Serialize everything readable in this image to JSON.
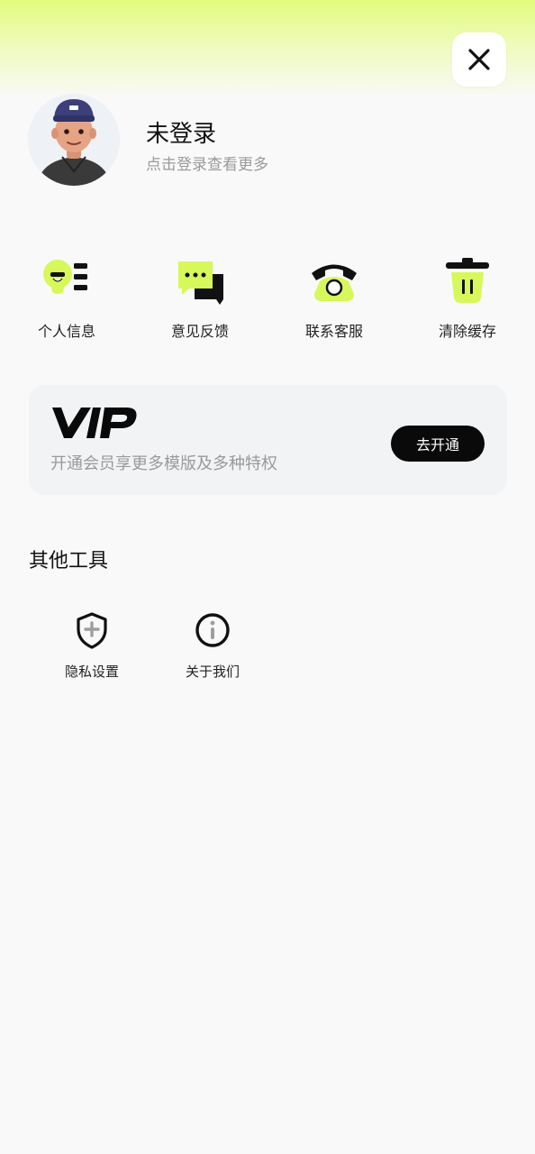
{
  "header": {
    "close_icon": "close-icon"
  },
  "profile": {
    "name": "未登录",
    "subtitle": "点击登录查看更多",
    "avatar_icon": "avatar-icon"
  },
  "quick_actions": [
    {
      "label": "个人信息",
      "icon": "person-info-icon"
    },
    {
      "label": "意见反馈",
      "icon": "feedback-chat-icon"
    },
    {
      "label": "联系客服",
      "icon": "phone-icon"
    },
    {
      "label": "清除缓存",
      "icon": "trash-icon"
    }
  ],
  "vip": {
    "logo_text": "VIP",
    "description": "开通会员享更多模版及多种特权",
    "button_label": "去开通"
  },
  "tools": {
    "title": "其他工具",
    "items": [
      {
        "label": "隐私设置",
        "icon": "shield-icon"
      },
      {
        "label": "关于我们",
        "icon": "info-icon"
      }
    ]
  },
  "colors": {
    "accent": "#d7f85a",
    "page_background": "#f9f9f9",
    "card_background": "#f2f3f5",
    "button_dark": "#0a0a0a",
    "muted_text": "#9a9a9a"
  }
}
